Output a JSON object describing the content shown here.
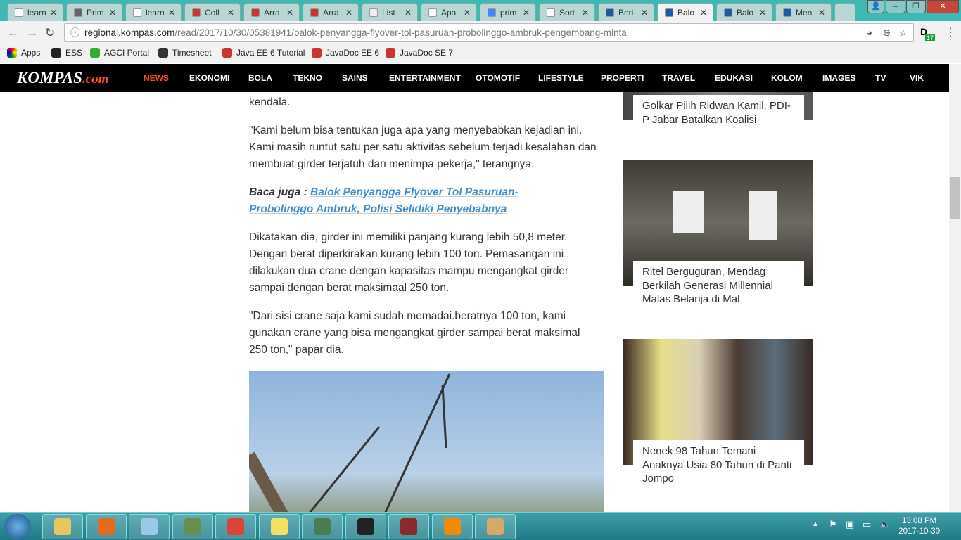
{
  "tabs": [
    {
      "label": "learn",
      "color": "#fff"
    },
    {
      "label": "Prim",
      "color": "#666"
    },
    {
      "label": "learn",
      "color": "#fff"
    },
    {
      "label": "Coll",
      "color": "#c33"
    },
    {
      "label": "Arra",
      "color": "#c33"
    },
    {
      "label": "Arra",
      "color": "#c33"
    },
    {
      "label": "List",
      "color": "#eee"
    },
    {
      "label": "Apa",
      "color": "#fff"
    },
    {
      "label": "prim",
      "color": "#4285f4"
    },
    {
      "label": "Sort",
      "color": "#fff"
    },
    {
      "label": "Beri",
      "color": "#1e5a9c"
    },
    {
      "label": "Balo",
      "color": "#1e5a9c",
      "active": true
    },
    {
      "label": "Balo",
      "color": "#1e5a9c"
    },
    {
      "label": "Men",
      "color": "#1e5a9c"
    }
  ],
  "url": {
    "host": "regional.kompas.com",
    "path": "/read/2017/10/30/05381941/balok-penyangga-flyover-tol-pasuruan-probolinggo-ambruk-pengembang-minta"
  },
  "extension_badge": "17",
  "bookmarks": [
    "Apps",
    "ESS",
    "AGCI Portal",
    "Timesheet",
    "Java EE 6 Tutorial",
    "JavaDoc EE 6",
    "JavaDoc SE 7"
  ],
  "logo": {
    "main": "KOMPAS",
    "suffix": ".com"
  },
  "nav": [
    "NEWS",
    "EKONOMI",
    "BOLA",
    "TEKNO",
    "SAINS",
    "ENTERTAINMENT",
    "OTOMOTIF",
    "LIFESTYLE",
    "PROPERTI",
    "TRAVEL",
    "EDUKASI",
    "KOLOM",
    "IMAGES",
    "TV",
    "VIK"
  ],
  "article": {
    "p0": "kendala.",
    "p1": "\"Kami belum bisa tentukan juga apa yang menyebabkan kejadian ini. Kami masih runtut satu per satu aktivitas sebelum terjadi kesalahan dan membuat girder terjatuh dan menimpa pekerja,\" terangnya.",
    "baca_label": "Baca juga : ",
    "baca_link": "Balok Penyangga Flyover Tol Pasuruan-Probolinggo Ambruk, Polisi Selidiki Penyebabnya",
    "p2": "Dikatakan dia, girder ini memiliki panjang kurang lebih 50,8 meter. Dengan berat diperkirakan kurang lebih 100 ton. Pemasangan ini dilakukan dua crane dengan kapasitas mampu mengangkat girder sampai dengan berat maksimaal 250 ton.",
    "p3": "\"Dari sisi crane saja kami sudah memadai.beratnya 100 ton, kami gunakan crane yang bisa mengangkat girder sampai berat maksimal 250 ton,\" papar dia."
  },
  "sidebar": [
    "Golkar Pilih Ridwan Kamil, PDI-P Jabar Batalkan Koalisi",
    "Ritel Berguguran, Mendag Berkilah Generasi Millennial Malas Belanja di Mal",
    "Nenek 98 Tahun Temani Anaknya Usia 80 Tahun di Panti Jompo"
  ],
  "clock": {
    "time": "13:08 PM",
    "date": "2017-10-30"
  }
}
